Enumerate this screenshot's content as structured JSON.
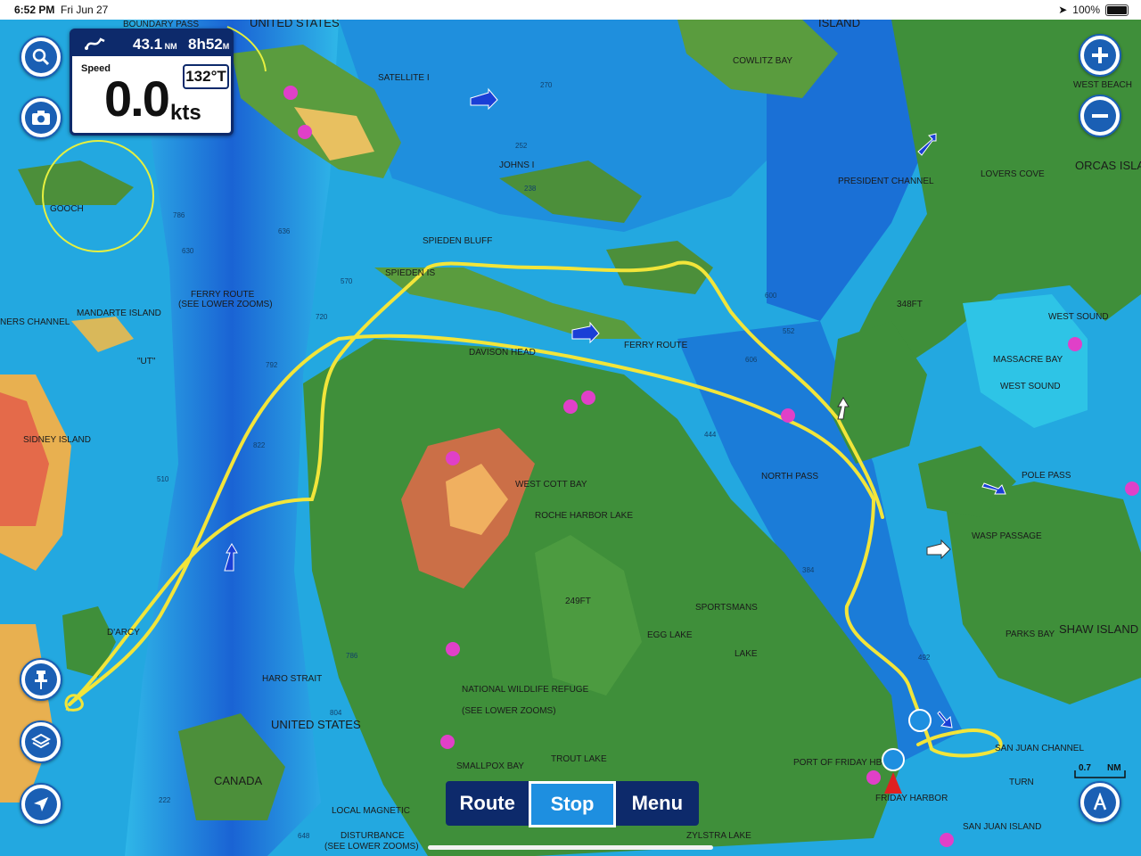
{
  "status_bar": {
    "time": "6:52 PM",
    "date": "Fri Jun 27",
    "battery": "100%"
  },
  "info_panel": {
    "distance": "43.1",
    "distance_unit": "NM",
    "eta": "8h52",
    "eta_unit": "M",
    "speed_label": "Speed",
    "speed_value": "0.0",
    "speed_unit": "kts",
    "heading": "132°T"
  },
  "bottom_bar": {
    "route_label": "Route",
    "stop_label": "Stop",
    "menu_label": "Menu"
  },
  "scale": {
    "value": "0.7",
    "unit": "NM"
  },
  "map_labels": {
    "boundary_pass": "BOUNDARY PASS",
    "united_states_top": "UNITED STATES",
    "island_top": "ISLAND",
    "cowlitz_bay": "COWLITZ BAY",
    "west_beach": "WEST BEACH",
    "satellite": "SATELLITE I",
    "johns": "JOHNS I",
    "president_channel": "PRESIDENT CHANNEL",
    "lovers_cove": "LOVERS COVE",
    "orcas_island": "ORCAS ISLAND",
    "gooch": "GOOCH",
    "spieden_bluff": "SPIEDEN BLUFF",
    "spieden_is": "SPIEDEN IS",
    "ferry_route": "FERRY ROUTE",
    "see_lower_zooms": "(SEE LOWER ZOOMS)",
    "ferry_route_2": "FERRY ROUTE",
    "mandarte_island": "MANDARTE ISLAND",
    "channel": "NERS CHANNEL",
    "ut": "\"UT\"",
    "davison_head": "DAVISON HEAD",
    "depth_348": "348FT",
    "west_sound": "WEST SOUND",
    "massacre_bay": "MASSACRE BAY",
    "west_sound_2": "WEST SOUND",
    "sidney_island": "SIDNEY ISLAND",
    "west_cott_bay": "WEST COTT BAY",
    "roche_harbor_lake": "ROCHE HARBOR LAKE",
    "north_pass": "NORTH PASS",
    "pole_pass": "POLE PASS",
    "wasp_passage": "WASP PASSAGE",
    "depth_249": "249FT",
    "sportsmans": "SPORTSMANS",
    "egg_lake": "EGG LAKE",
    "lake": "LAKE",
    "parks_bay": "PARKS BAY",
    "shaw_island": "SHAW ISLAND",
    "haro_strait": "HARO STRAIT",
    "united_states_mid": "UNITED STATES",
    "national_wildlife": "NATIONAL WILDLIFE REFUGE",
    "see_lower_zooms_3": "(SEE LOWER ZOOMS)",
    "canada": "CANADA",
    "smallpox_bay": "SMALLPOX BAY",
    "trout_lake": "TROUT LAKE",
    "port_of_friday_hbr": "PORT OF FRIDAY HBR",
    "friday_harbor": "FRIDAY HARBOR",
    "san_juan_channel": "SAN JUAN CHANNEL",
    "san_juan_island": "SAN JUAN ISLAND",
    "turn": "TURN",
    "local_magnetic": "LOCAL MAGNETIC",
    "disturbance": "DISTURBANCE",
    "see_lower_zooms_4": "(SEE LOWER ZOOMS)",
    "zylstra_lake": "ZYLSTRA LAKE",
    "d_arcy": "D'ARCY"
  },
  "depths": [
    "270",
    "252",
    "238",
    "786",
    "630",
    "636",
    "570",
    "720",
    "792",
    "822",
    "510",
    "600",
    "552",
    "606",
    "444",
    "384",
    "786",
    "804",
    "222",
    "648",
    "492"
  ],
  "colors": {
    "track": "#f2e53a",
    "deep_water": "#1e6fd0",
    "shallow_water": "#2ec4e6",
    "land": "#3f8f3a",
    "shoal": "#e8a040",
    "accent": "#0d2a6b"
  }
}
